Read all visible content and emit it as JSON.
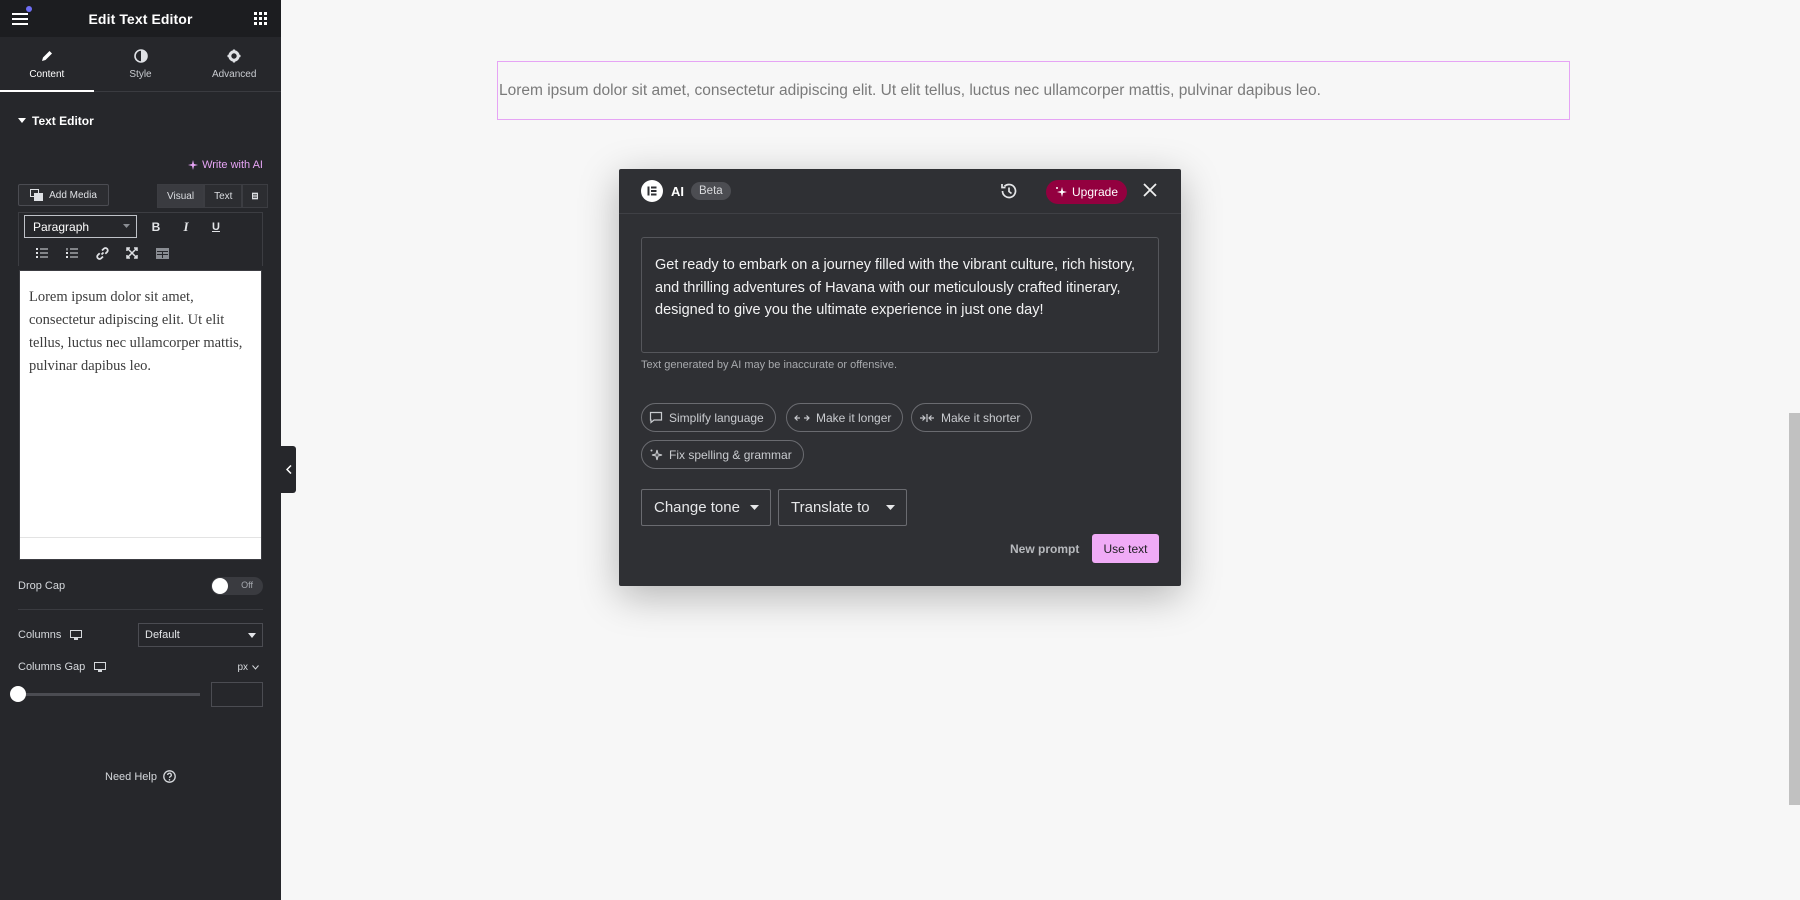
{
  "panel": {
    "title": "Edit Text Editor",
    "tabs": [
      {
        "label": "Content",
        "icon": "pencil-icon"
      },
      {
        "label": "Style",
        "icon": "half-circle-icon"
      },
      {
        "label": "Advanced",
        "icon": "gear-icon"
      }
    ],
    "section_title": "Text Editor",
    "write_with_ai": "Write with AI",
    "editor": {
      "add_media": "Add Media",
      "mode_visual": "Visual",
      "mode_text": "Text",
      "format_select": "Paragraph",
      "bold": "B",
      "italic": "I",
      "underline": "U",
      "content": "Lorem ipsum dolor sit amet, consectetur adipiscing elit. Ut elit tellus, luctus nec ullamcorper mattis, pulvinar dapibus leo."
    },
    "drop_cap": {
      "label": "Drop Cap",
      "state": "Off"
    },
    "columns": {
      "label": "Columns",
      "value": "Default"
    },
    "columns_gap": {
      "label": "Columns Gap",
      "unit": "px",
      "value": ""
    },
    "need_help": "Need Help"
  },
  "preview": {
    "text": "Lorem ipsum dolor sit amet, consectetur adipiscing elit. Ut elit tellus, luctus nec ullamcorper mattis, pulvinar dapibus leo."
  },
  "ai_modal": {
    "title": "AI",
    "badge": "Beta",
    "upgrade_label": "Upgrade",
    "generated_text": "Get ready to embark on a journey filled with the vibrant culture, rich history, and thrilling adventures of Havana with our meticulously crafted itinerary, designed to give you the ultimate experience in just one day!",
    "disclaimer": "Text generated by AI may be inaccurate or offensive.",
    "chips": [
      {
        "label": "Simplify language",
        "icon": "speech-bubble-icon"
      },
      {
        "label": "Make it longer",
        "icon": "expand-arrows-icon"
      },
      {
        "label": "Make it shorter",
        "icon": "shrink-arrows-icon"
      },
      {
        "label": "Fix spelling & grammar",
        "icon": "sparkle-icon"
      }
    ],
    "change_tone": "Change tone",
    "translate_to": "Translate to",
    "new_prompt": "New prompt",
    "use_text": "Use text"
  },
  "colors": {
    "panel_bg": "#26272b",
    "accent_pink": "#f0abf6",
    "upgrade_bg": "#93003f",
    "modal_bg": "#2f3034",
    "notification_dot": "#6f6ef5"
  }
}
